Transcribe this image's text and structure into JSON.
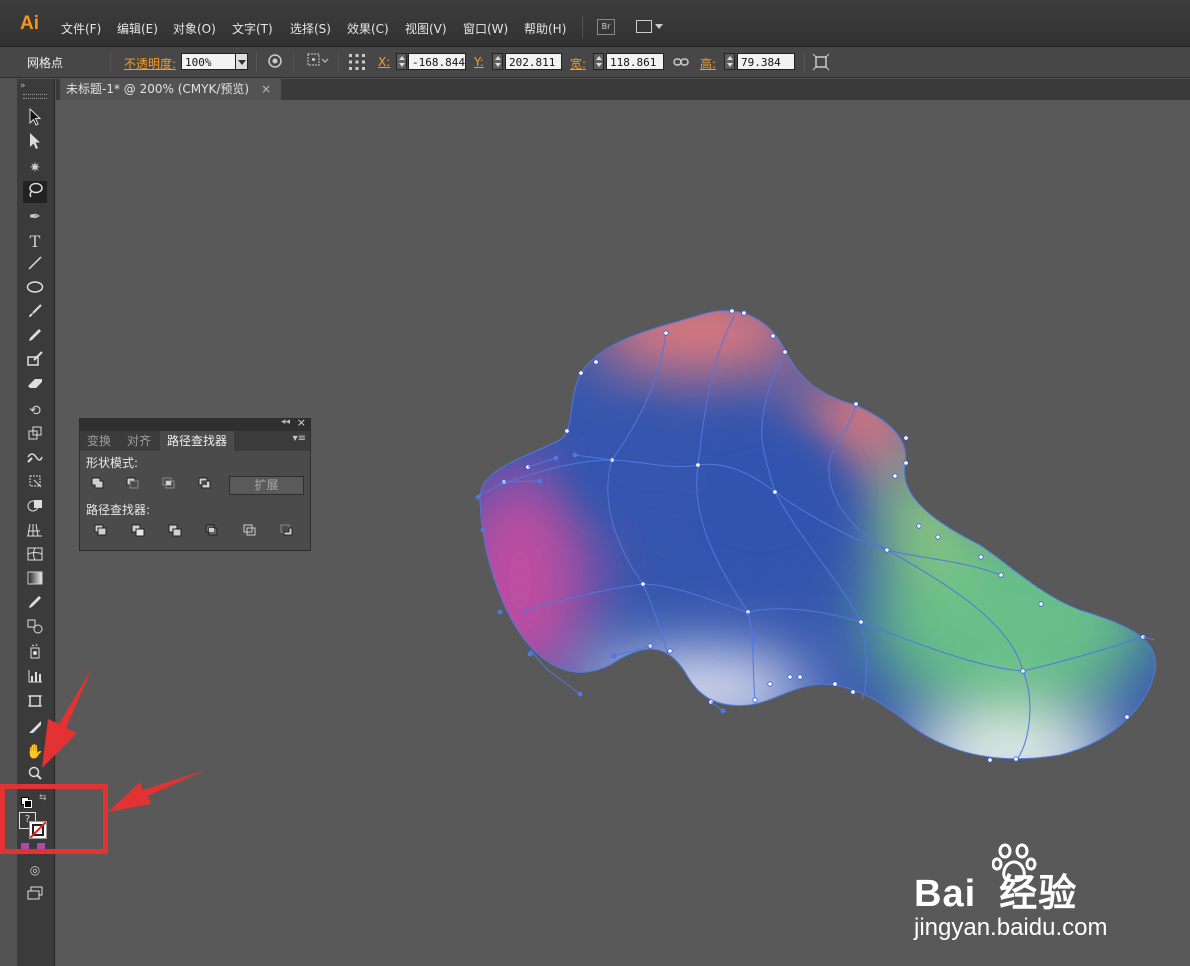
{
  "app": {
    "logo": "Ai"
  },
  "menu": [
    "文件(F)",
    "编辑(E)",
    "对象(O)",
    "文字(T)",
    "选择(S)",
    "效果(C)",
    "视图(V)",
    "窗口(W)",
    "帮助(H)"
  ],
  "menu_extra": {
    "bridge_label": "Br"
  },
  "control_bar": {
    "selection_label": "网格点",
    "opacity_label": "不透明度:",
    "opacity_value": "100%",
    "x_label": "X:",
    "x_value": "-168.844",
    "y_label": "Y:",
    "y_value": "202.811 ı",
    "w_label": "宽:",
    "w_value": "118.861 ı",
    "h_label": "高:",
    "h_value": "79.384 mı"
  },
  "document": {
    "tab_title": "未标题-1* @ 200% (CMYK/预览)",
    "close_glyph": "×"
  },
  "panel": {
    "tabs": [
      "变换",
      "对齐",
      "路径查找器"
    ],
    "active_tab": 2,
    "shape_modes_label": "形状模式:",
    "expand_button": "扩展",
    "pathfinder_label": "路径查找器:"
  },
  "tools": [
    "selection-tool",
    "direct-selection-tool",
    "magic-wand-tool",
    "lasso-tool",
    "pen-tool",
    "type-tool",
    "line-tool",
    "ellipse-tool",
    "paintbrush-tool",
    "pencil-tool",
    "blob-brush-tool",
    "eraser-tool",
    "rotate-tool",
    "scale-tool",
    "warp-tool",
    "free-transform-tool",
    "shape-builder-tool",
    "perspective-grid-tool",
    "mesh-tool",
    "gradient-tool",
    "eyedropper-tool",
    "blend-tool",
    "symbol-sprayer-tool",
    "column-graph-tool",
    "artboard-tool",
    "slice-tool",
    "hand-tool",
    "zoom-tool"
  ],
  "color_swatch": {
    "question_mark": "?"
  },
  "watermark": {
    "brand": "Bai  经验",
    "url": "jingyan.baidu.com"
  },
  "colors": {
    "accent_orange": "#f39c2b",
    "annotation_red": "#e33232",
    "mesh_blue": "#3355b0",
    "mesh_red": "#ea7a78",
    "mesh_green": "#67bf88",
    "mesh_magenta": "#c04ea0"
  }
}
